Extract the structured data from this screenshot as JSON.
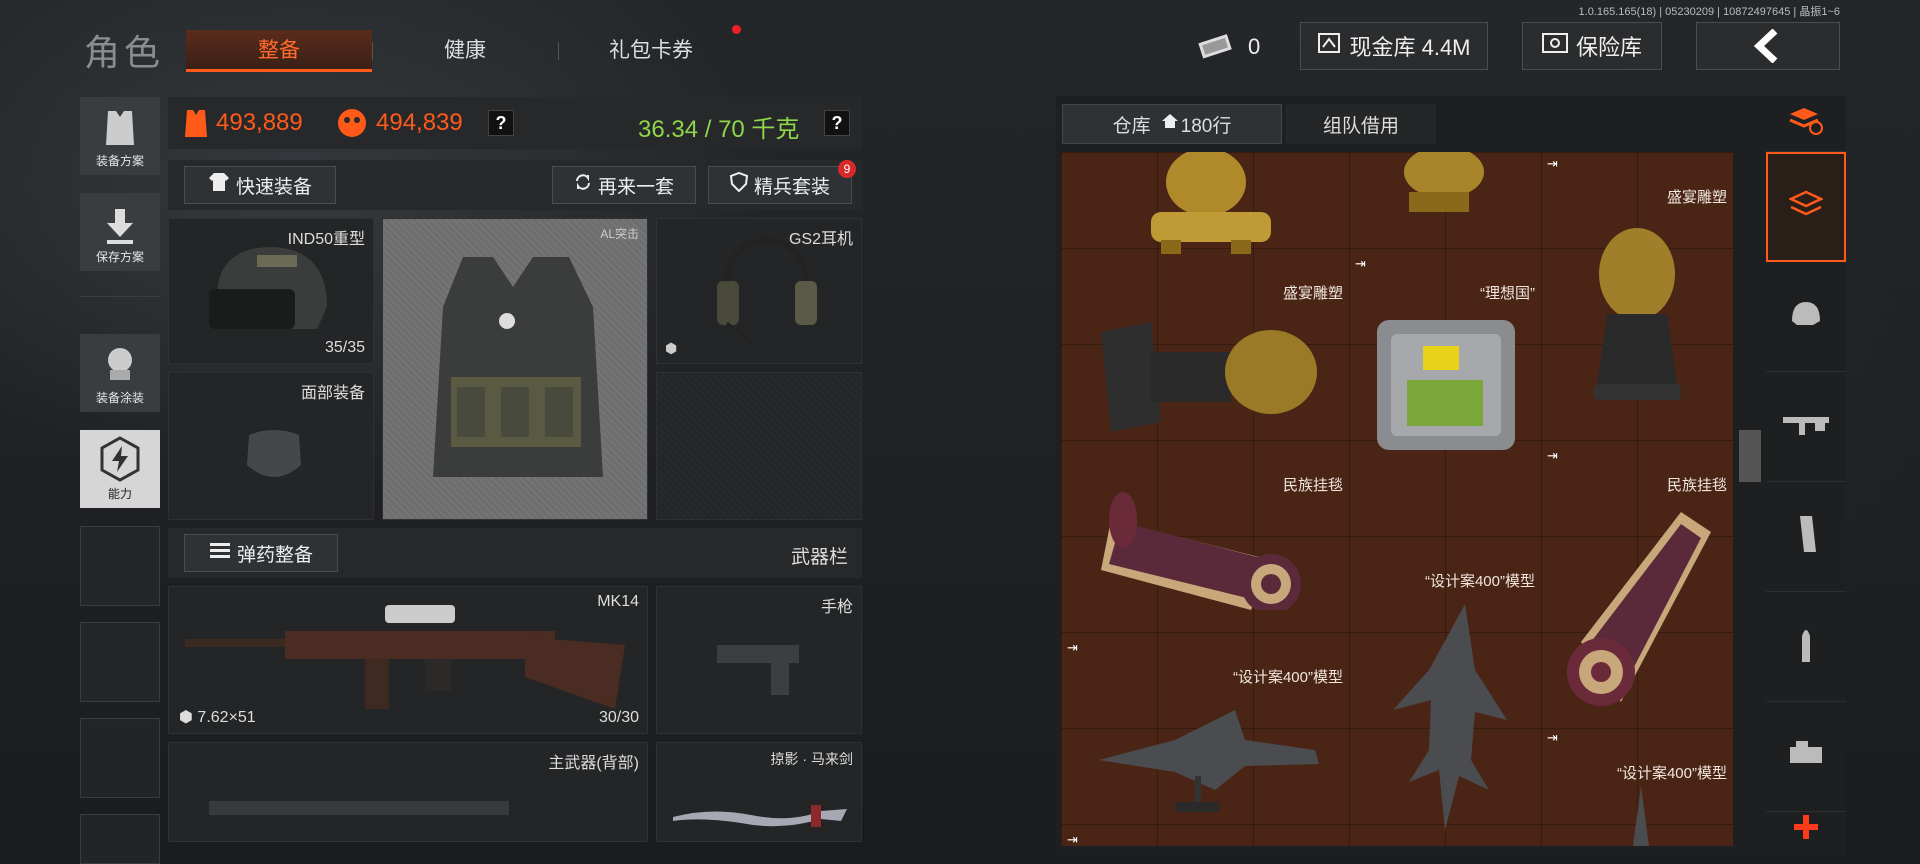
{
  "version": "1.0.165.165(18) | 05230209 | 10872497645 | 晶振1~6",
  "page_title": "角色",
  "tabs": [
    {
      "label": "整备",
      "active": true
    },
    {
      "label": "健康",
      "active": false
    },
    {
      "label": "礼包卡券",
      "active": false,
      "badge": true
    }
  ],
  "topbar": {
    "ticket_count": "0",
    "cash_label": "现金库 4.4M",
    "safe_label": "保险库"
  },
  "sidebar": [
    {
      "label": "装备方案",
      "icon": "vest-icon"
    },
    {
      "label": "保存方案",
      "icon": "download-icon"
    },
    {
      "label": "装备涂装",
      "icon": "paint-icon"
    },
    {
      "label": "能力",
      "icon": "ability-icon"
    }
  ],
  "stats": {
    "armor_value": "493,889",
    "gear_value": "494,839",
    "weight": "36.34 / 70 千克",
    "help": "?"
  },
  "actions": {
    "quick_equip": "快速装备",
    "again": "再来一套",
    "elite": "精兵套装",
    "elite_badge": "9"
  },
  "slots": {
    "helmet": {
      "name": "IND50重型",
      "count": "35/35"
    },
    "vest": {
      "name": "AL突击"
    },
    "headset": {
      "name": "GS2耳机"
    },
    "face": {
      "name": "面部装备"
    },
    "ammo_btn": "弹药整备",
    "weapon_bar": "武器栏",
    "primary": {
      "name": "MK14",
      "ammo": "7.62×51",
      "count": "30/30"
    },
    "pistol": {
      "name": "手枪"
    },
    "back": {
      "name": "主武器(背部)"
    },
    "melee": {
      "name": "掠影 · 马来剑"
    }
  },
  "warehouse": {
    "tab_label": "仓库",
    "tab_rows": "180行",
    "tab2": "组队借用",
    "items": [
      {
        "label": "盛宴雕塑"
      },
      {
        "label": "盛宴雕塑"
      },
      {
        "label": "“理想国”"
      },
      {
        "label": "民族挂毯"
      },
      {
        "label": "民族挂毯"
      },
      {
        "label": "“设计案400”模型"
      },
      {
        "label": "“设计案400”模型"
      },
      {
        "label": "“设计案400”模型"
      }
    ]
  },
  "colors": {
    "accent": "#ff5a1a",
    "weight_ok": "#8fd64a",
    "grid_bg": "#4a2516"
  }
}
